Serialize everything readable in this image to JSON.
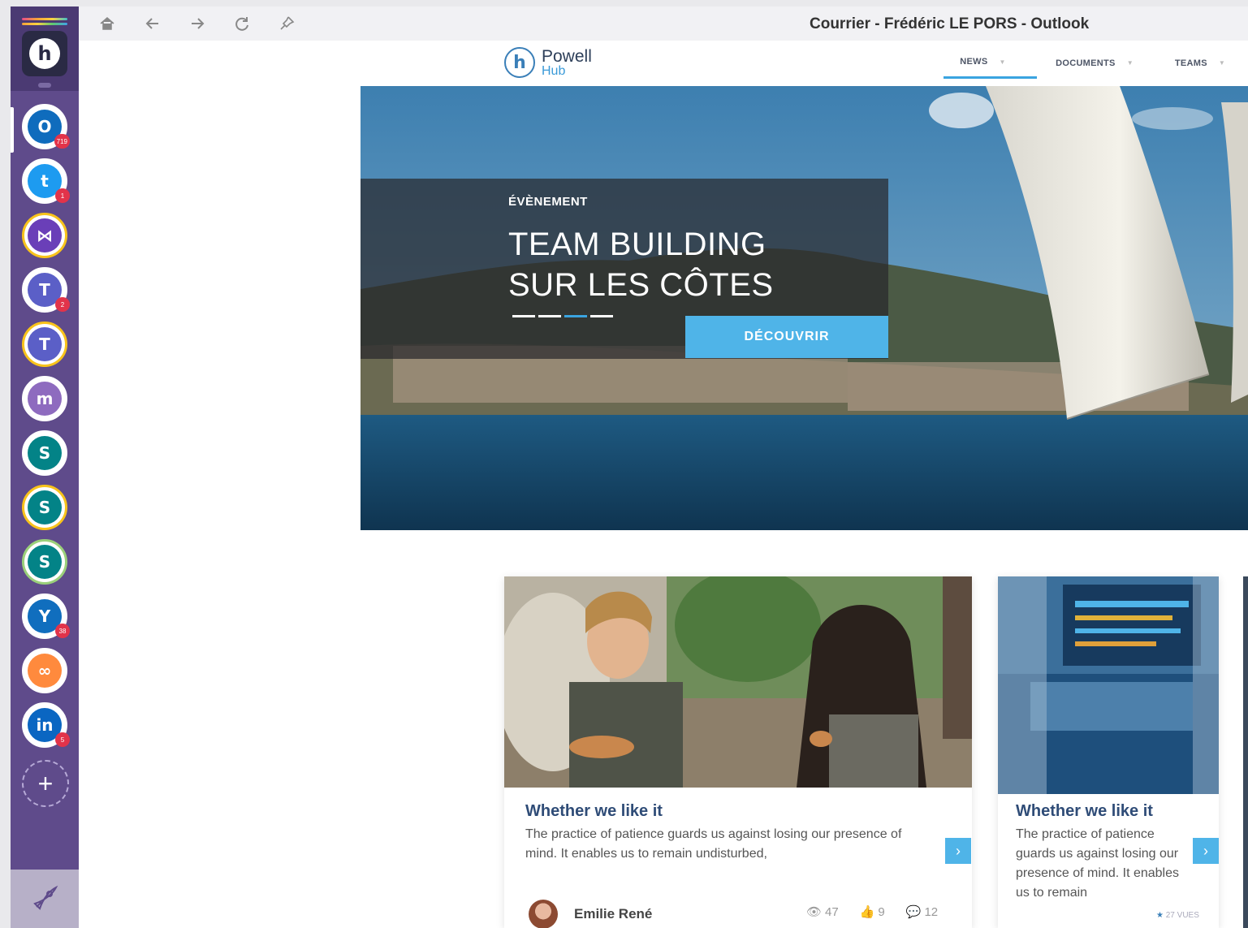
{
  "window": {
    "title": "Courrier - Frédéric LE PORS - Outlook"
  },
  "toolbar": {
    "icons": [
      "home-icon",
      "back-arrow-icon",
      "forward-arrow-icon",
      "refresh-icon",
      "pin-icon"
    ]
  },
  "sidebar": {
    "apps": [
      {
        "name": "outlook",
        "glyph": "O",
        "bg": "#0f6cbd",
        "ring": "#ffffff",
        "badge": "719"
      },
      {
        "name": "twitter",
        "glyph": "t",
        "bg": "#1d9bf0",
        "ring": "#ffffff",
        "badge": "1"
      },
      {
        "name": "visual-studio",
        "glyph": "⋈",
        "bg": "#6a3fb8",
        "ring": "#f8c31b",
        "badge": ""
      },
      {
        "name": "teams",
        "glyph": "T",
        "bg": "#5b5fc7",
        "ring": "#ffffff",
        "badge": "2"
      },
      {
        "name": "teams-2",
        "glyph": "T",
        "bg": "#5b5fc7",
        "ring": "#f8c31b",
        "badge": ""
      },
      {
        "name": "powell",
        "glyph": "m",
        "bg": "#8e6bbf",
        "ring": "#ffffff",
        "badge": ""
      },
      {
        "name": "sharepoint",
        "glyph": "S",
        "bg": "#038387",
        "ring": "#ffffff",
        "badge": ""
      },
      {
        "name": "sharepoint-2",
        "glyph": "S",
        "bg": "#038387",
        "ring": "#f8c31b",
        "badge": ""
      },
      {
        "name": "sharepoint-3",
        "glyph": "S",
        "bg": "#038387",
        "ring": "#9ad07a",
        "badge": ""
      },
      {
        "name": "yammer",
        "glyph": "Y",
        "bg": "#106ebe",
        "ring": "#ffffff",
        "badge": "38"
      },
      {
        "name": "link",
        "glyph": "∞",
        "bg": "#ff8a3d",
        "ring": "#ffffff",
        "badge": ""
      },
      {
        "name": "linkedin",
        "glyph": "in",
        "bg": "#0a66c2",
        "ring": "#ffffff",
        "badge": "5"
      }
    ],
    "add_label": "+"
  },
  "brand": {
    "name": "Powell",
    "sub": "Hub"
  },
  "nav": [
    {
      "label": "NEWS"
    },
    {
      "label": "DOCUMENTS"
    },
    {
      "label": "TEAMS"
    }
  ],
  "hero": {
    "tag": "ÉVÈNEMENT",
    "title_line1": "TEAM BUILDING",
    "title_line2": "SUR LES CÔTES",
    "button": "DÉCOUVRIR",
    "slides": 4,
    "active_slide": 3
  },
  "cards": [
    {
      "title": "Whether we like it",
      "text": "The practice of patience guards us against losing our presence of mind. It enables us to remain undisturbed,",
      "author": "Emilie René",
      "views": "47",
      "likes": "9",
      "comments": "12"
    },
    {
      "title": "Whether we like it",
      "text": "The practice of patience guards us against losing our presence of mind. It enables us to remain",
      "views_label": "27 VUES"
    }
  ],
  "colors": {
    "accent": "#4fb4e8",
    "sidebar": "#5f4b8b",
    "title_blue": "#2f4c77"
  }
}
